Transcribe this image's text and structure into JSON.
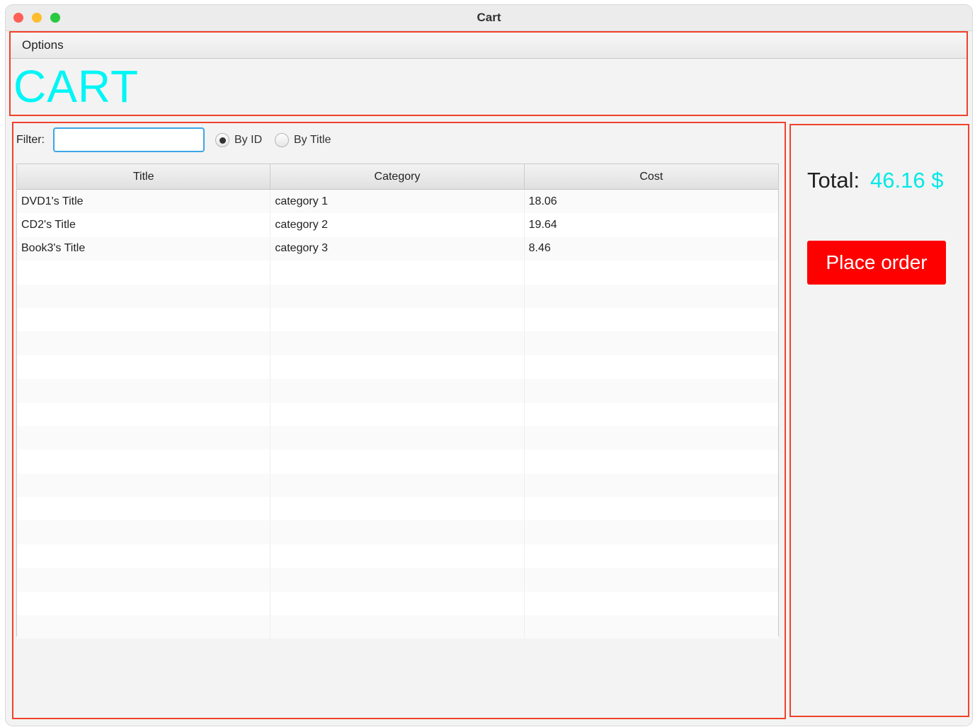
{
  "window": {
    "title": "Cart"
  },
  "menubar": {
    "items": [
      {
        "label": "Options"
      }
    ]
  },
  "header": {
    "heading": "CART",
    "heading_color": "#00f6f6"
  },
  "filter": {
    "label": "Filter:",
    "value": "",
    "options": [
      {
        "label": "By ID",
        "selected": true
      },
      {
        "label": "By Title",
        "selected": false
      }
    ]
  },
  "table": {
    "columns": [
      "Title",
      "Category",
      "Cost"
    ],
    "rows": [
      {
        "title": "DVD1's Title",
        "category": "category 1",
        "cost": "18.06"
      },
      {
        "title": "CD2's Title",
        "category": "category 2",
        "cost": "19.64"
      },
      {
        "title": "Book3's Title",
        "category": "category 3",
        "cost": "8.46"
      }
    ]
  },
  "summary": {
    "total_label": "Total:",
    "total_value": "46.16 $",
    "total_color": "#00e8e8",
    "place_order_label": "Place order",
    "place_order_color": "#ff0000"
  },
  "colors": {
    "region_border": "#f0412b"
  }
}
